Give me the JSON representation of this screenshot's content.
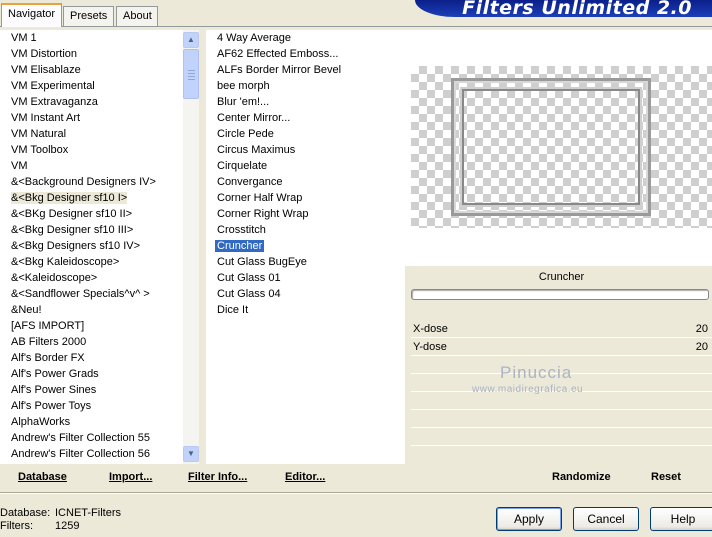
{
  "tabs": [
    "Navigator",
    "Presets",
    "About"
  ],
  "banner_title": "Filters Unlimited 2.0",
  "categories": [
    "VM 1",
    "VM Distortion",
    "VM Elisablaze",
    "VM Experimental",
    "VM Extravaganza",
    "VM Instant Art",
    "VM Natural",
    "VM Toolbox",
    "VM",
    "&<Background Designers IV>",
    "&<Bkg Designer sf10 I>",
    "&<BKg Designer sf10 II>",
    "&<Bkg Designer sf10 III>",
    "&<Bkg Designers sf10 IV>",
    "&<Bkg Kaleidoscope>",
    "&<Kaleidoscope>",
    "&<Sandflower Specials^v^ >",
    "&Neu!",
    "[AFS IMPORT]",
    "AB Filters 2000",
    "Alf's Border FX",
    "Alf's Power Grads",
    "Alf's Power Sines",
    "Alf's Power Toys",
    "AlphaWorks",
    "Andrew's Filter Collection 55",
    "Andrew's Filter Collection 56"
  ],
  "selected_category": "&<Bkg Designer sf10 I>",
  "filters": [
    "4 Way Average",
    "AF62 Effected Emboss...",
    "ALFs Border Mirror Bevel",
    "bee morph",
    "Blur 'em!...",
    "Center Mirror...",
    "Circle Pede",
    "Circus Maximus",
    "Cirquelate",
    "Convergance",
    "Corner Half Wrap",
    "Corner Right Wrap",
    "Crosstitch",
    "Cruncher",
    "Cut Glass  BugEye",
    "Cut Glass 01",
    "Cut Glass 04",
    "Dice It"
  ],
  "selected_filter": "Cruncher",
  "current_filter_name": "Cruncher",
  "params": [
    {
      "name": "X-dose",
      "value": "20"
    },
    {
      "name": "Y-dose",
      "value": "20"
    }
  ],
  "watermark": {
    "line1": "Pinuccia",
    "line2": "www.maidiregrafica.eu"
  },
  "links": {
    "database": "Database",
    "import": "Import...",
    "filter_info": "Filter Info...",
    "editor": "Editor...",
    "randomize": "Randomize",
    "reset": "Reset"
  },
  "info": {
    "database_label": "Database:",
    "database_value": "ICNET-Filters",
    "filters_label": "Filters:",
    "filters_value": "1259"
  },
  "buttons": {
    "apply": "Apply",
    "cancel": "Cancel",
    "help": "Help"
  },
  "colors": {
    "selection": "#316ac5",
    "banner": "#1b3fb8",
    "window_bg": "#ece9d8"
  }
}
